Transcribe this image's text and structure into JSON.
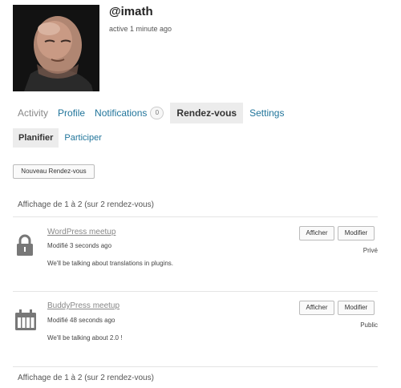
{
  "profile": {
    "username": "@imath",
    "last_active": "active 1 minute ago"
  },
  "nav": {
    "items": [
      {
        "label": "Activity"
      },
      {
        "label": "Profile"
      },
      {
        "label": "Notifications",
        "count": "0"
      },
      {
        "label": "Rendez-vous"
      },
      {
        "label": "Settings"
      }
    ]
  },
  "subnav": {
    "items": [
      {
        "label": "Planifier"
      },
      {
        "label": "Participer"
      }
    ]
  },
  "new_button_label": "Nouveau Rendez-vous",
  "pagination_text": "Affichage de 1 à 2 (sur 2 rendez-vous)",
  "rendezvous": [
    {
      "title": "WordPress meetup",
      "modified": "Modifié 3 seconds ago",
      "description": "We'll be talking about translations in plugins.",
      "status": "Privé",
      "icon": "lock-icon",
      "view_label": "Afficher",
      "edit_label": "Modifier"
    },
    {
      "title": "BuddyPress meetup",
      "modified": "Modifié 48 seconds ago",
      "description": "We'll be talking about 2.0 !",
      "status": "Public",
      "icon": "calendar-icon",
      "view_label": "Afficher",
      "edit_label": "Modifier"
    }
  ]
}
